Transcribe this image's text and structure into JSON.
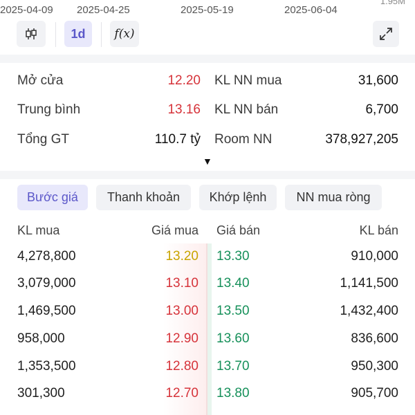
{
  "axis": {
    "dates": [
      "2025-04-09",
      "2025-04-25",
      "2025-05-19",
      "2025-06-04"
    ],
    "volume_label": "1.95M"
  },
  "toolbar": {
    "candle_icon": "candlestick-icon",
    "interval": "1d",
    "function_label": "f(x)",
    "expand_icon": "expand-icon"
  },
  "stats": {
    "rows": [
      {
        "label1": "Mở cửa",
        "value1": "12.20",
        "label2": "KL NN mua",
        "value2": "31,600"
      },
      {
        "label1": "Trung bình",
        "value1": "13.16",
        "label2": "KL NN bán",
        "value2": "6,700"
      },
      {
        "label1": "Tổng GT",
        "value1": "110.7 tỷ",
        "label2": "Room NN",
        "value2": "378,927,205"
      }
    ],
    "expand_caret": "▼"
  },
  "tabs": [
    "Bước giá",
    "Thanh khoản",
    "Khớp lệnh",
    "NN mua ròng"
  ],
  "order_book": {
    "headers": [
      "KL mua",
      "Giá mua",
      "Giá bán",
      "KL bán"
    ],
    "rows": [
      {
        "bid_vol": "4,278,800",
        "bid_price": "13.20",
        "ask_price": "13.30",
        "ask_vol": "910,000"
      },
      {
        "bid_vol": "3,079,000",
        "bid_price": "13.10",
        "ask_price": "13.40",
        "ask_vol": "1,141,500"
      },
      {
        "bid_vol": "1,469,500",
        "bid_price": "13.00",
        "ask_price": "13.50",
        "ask_vol": "1,432,400"
      },
      {
        "bid_vol": "958,000",
        "bid_price": "12.90",
        "ask_price": "13.60",
        "ask_vol": "836,600"
      },
      {
        "bid_vol": "1,353,500",
        "bid_price": "12.80",
        "ask_price": "13.70",
        "ask_vol": "950,300"
      },
      {
        "bid_vol": "301,300",
        "bid_price": "12.70",
        "ask_price": "13.80",
        "ask_vol": "905,700"
      }
    ]
  },
  "colors": {
    "red": "#d6333a",
    "green": "#16905a",
    "yellow": "#c8a400",
    "accent": "#5b57c9"
  }
}
